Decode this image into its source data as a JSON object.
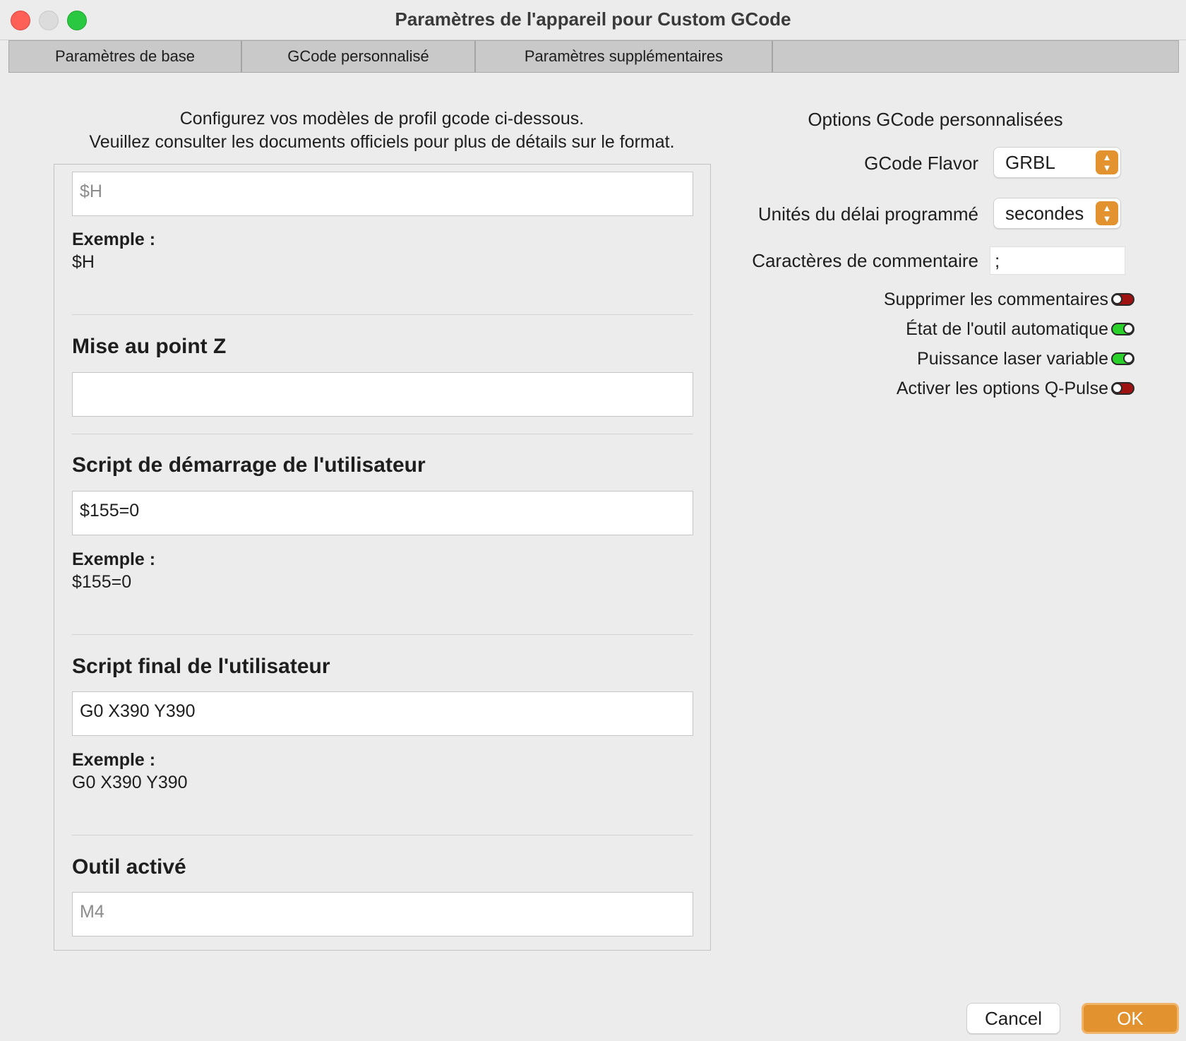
{
  "window": {
    "title": "Paramètres de l'appareil pour Custom GCode"
  },
  "tabs": [
    {
      "label": "Paramètres de base"
    },
    {
      "label": "GCode personnalisé"
    },
    {
      "label": "Paramètres supplémentaires"
    }
  ],
  "intro": {
    "line1": "Configurez vos modèles de profil gcode ci-dessous.",
    "line2": "Veuillez consulter les documents officiels pour plus de détails sur le format."
  },
  "sections": {
    "homing": {
      "placeholder": "$H",
      "example_label": "Exemple :",
      "example_value": "$H"
    },
    "z_focus": {
      "title": "Mise au point Z",
      "value": ""
    },
    "start_script": {
      "title": "Script de démarrage de l'utilisateur",
      "value": "$155=0",
      "example_label": "Exemple :",
      "example_value": "$155=0"
    },
    "end_script": {
      "title": "Script final de l'utilisateur",
      "value": "G0 X390 Y390",
      "example_label": "Exemple :",
      "example_value": "G0 X390 Y390"
    },
    "tool_on": {
      "title": "Outil activé",
      "placeholder": "M4"
    }
  },
  "options": {
    "title": "Options GCode personnalisées",
    "flavor": {
      "label": "GCode Flavor",
      "value": "GRBL"
    },
    "dwell_units": {
      "label": "Unités du délai programmé",
      "value": "secondes"
    },
    "comment_chars": {
      "label": "Caractères de commentaire",
      "value": ";"
    },
    "toggles": [
      {
        "label": "Supprimer les commentaires",
        "state": "off"
      },
      {
        "label": "État de l'outil automatique",
        "state": "on"
      },
      {
        "label": "Puissance laser variable",
        "state": "on"
      },
      {
        "label": "Activer les options Q-Pulse",
        "state": "off"
      }
    ]
  },
  "buttons": {
    "cancel": "Cancel",
    "ok": "OK"
  },
  "colors": {
    "accent": "#e2922f",
    "toggle_on": "#2ad12a",
    "toggle_off": "#9e1212"
  }
}
